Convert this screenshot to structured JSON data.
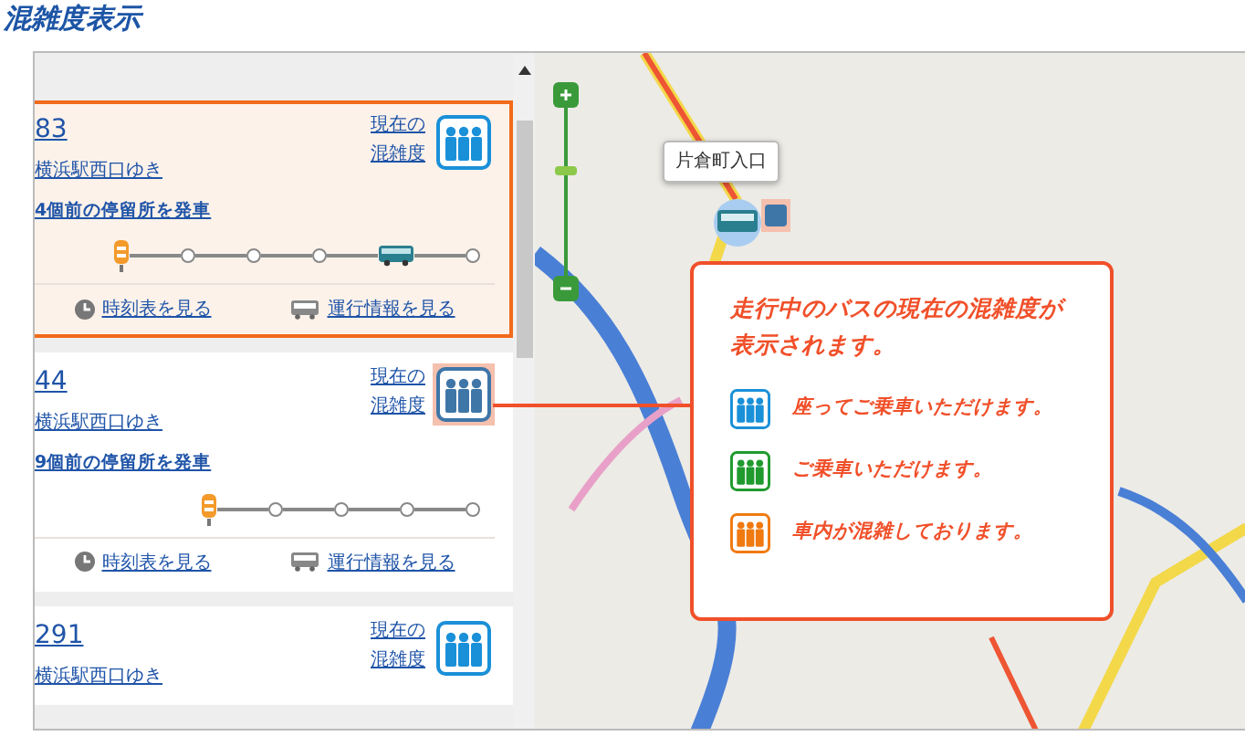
{
  "title": "混雑度表示",
  "buses": [
    {
      "route": "83",
      "destination": "横浜駅西口ゆき",
      "crowd_link": [
        "現在の",
        "混雑度"
      ],
      "highlighted": false,
      "selected": true,
      "status": "4個前の停留所を発車",
      "track": [
        {
          "kind": "origin"
        },
        {
          "kind": "stop"
        },
        {
          "kind": "stop"
        },
        {
          "kind": "stop"
        },
        {
          "kind": "bus"
        },
        {
          "kind": "stop"
        }
      ],
      "links": [
        "時刻表を見る",
        "運行情報を見る"
      ]
    },
    {
      "route": "44",
      "destination": "横浜駅西口ゆき",
      "crowd_link": [
        "現在の",
        "混雑度"
      ],
      "highlighted": true,
      "selected": false,
      "status": "9個前の停留所を発車",
      "track": [
        {
          "kind": "origin"
        },
        {
          "kind": "stop"
        },
        {
          "kind": "stop"
        },
        {
          "kind": "stop"
        },
        {
          "kind": "stop"
        }
      ],
      "links": [
        "時刻表を見る",
        "運行情報を見る"
      ]
    },
    {
      "route": "291",
      "destination": "横浜駅西口ゆき",
      "crowd_link": [
        "現在の",
        "混雑度"
      ],
      "highlighted": false,
      "selected": false
    }
  ],
  "map": {
    "stop_popup": "片倉町入口"
  },
  "callout": {
    "intro": "走行中のバスの現在の混雑度が表示されます。",
    "legend": [
      {
        "color": "#1a90d8",
        "text": "座ってご乗車いただけます。"
      },
      {
        "color": "#1f9a2e",
        "text": "ご乗車いただけます。"
      },
      {
        "color": "#f07a10",
        "text": "車内が混雑しております。"
      }
    ]
  }
}
